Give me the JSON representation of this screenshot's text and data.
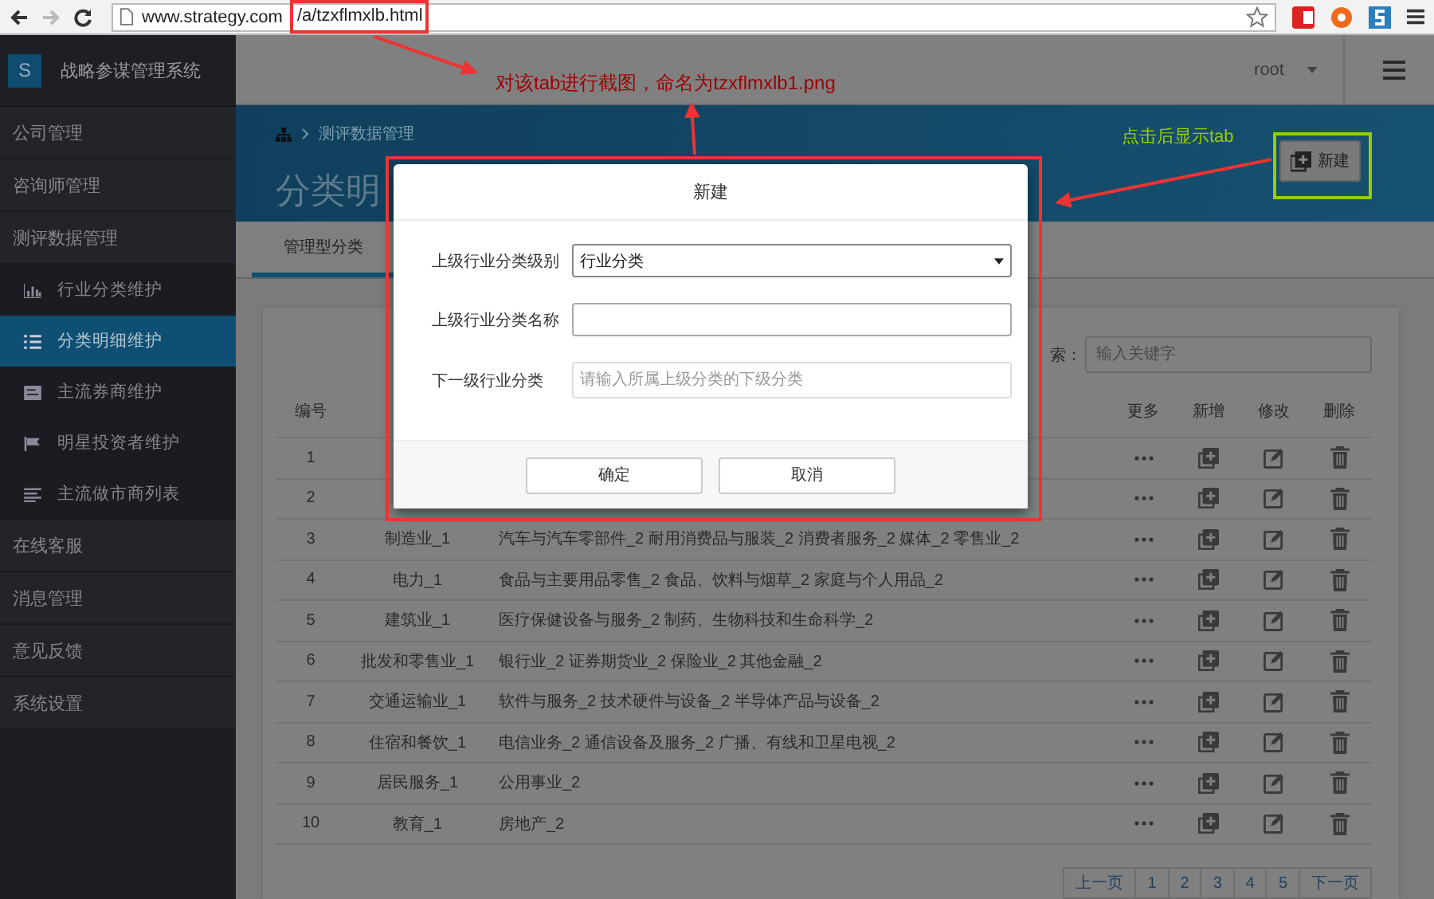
{
  "browser": {
    "url_host": "www.strategy.com",
    "url_path": "/a/tzxflmxlb.html"
  },
  "app": {
    "logo_letter": "S",
    "title": "战略参谋管理系统",
    "user": "root"
  },
  "sidebar": {
    "items": [
      {
        "label": "公司管理",
        "selected": false
      },
      {
        "label": "咨询师管理",
        "selected": false
      },
      {
        "label": "测评数据管理",
        "selected": false,
        "expanded": true,
        "children": [
          {
            "label": "行业分类维护",
            "selected": false
          },
          {
            "label": "分类明细维护",
            "selected": true
          },
          {
            "label": "主流券商维护",
            "selected": false
          },
          {
            "label": "明星投资者维护",
            "selected": false
          },
          {
            "label": "主流做市商列表",
            "selected": false
          }
        ]
      },
      {
        "label": "在线客服",
        "selected": false
      },
      {
        "label": "消息管理",
        "selected": false
      },
      {
        "label": "意见反馈",
        "selected": false
      },
      {
        "label": "系统设置",
        "selected": false
      }
    ]
  },
  "banner": {
    "breadcrumb": "测评数据管理",
    "title": "分类明",
    "new_button": "新建"
  },
  "tabs": [
    {
      "label": "管理型分类",
      "selected": true
    }
  ],
  "search": {
    "label": "索：",
    "placeholder": "输入关键字"
  },
  "table": {
    "columns": [
      "编号",
      "更多",
      "新增",
      "修改",
      "删除"
    ],
    "rows": [
      {
        "number": "1"
      },
      {
        "number": "2"
      },
      {
        "number": "3",
        "name": "制造业_1",
        "details": "汽车与汽车零部件_2  耐用消费品与服装_2  消费者服务_2  媒体_2  零售业_2"
      },
      {
        "number": "4",
        "name": "电力_1",
        "details": "食品与主要用品零售_2  食品、饮料与烟草_2  家庭与个人用品_2"
      },
      {
        "number": "5",
        "name": "建筑业_1",
        "details": "医疗保健设备与服务_2  制药、生物科技和生命科学_2"
      },
      {
        "number": "6",
        "name": "批发和零售业_1",
        "details": "银行业_2  证券期货业_2  保险业_2  其他金融_2"
      },
      {
        "number": "7",
        "name": "交通运输业_1",
        "details": "软件与服务_2  技术硬件与设备_2  半导体产品与设备_2"
      },
      {
        "number": "8",
        "name": "住宿和餐饮_1",
        "details": "电信业务_2  通信设备及服务_2  广播、有线和卫星电视_2"
      },
      {
        "number": "9",
        "name": "居民服务_1",
        "details": "公用事业_2"
      },
      {
        "number": "10",
        "name": "教育_1",
        "details": "房地产_2"
      }
    ]
  },
  "pagination": {
    "prev": "上一页",
    "pages": [
      "1",
      "2",
      "3",
      "4",
      "5"
    ],
    "next": "下一页"
  },
  "modal": {
    "title": "新建",
    "fields": [
      {
        "kind": "select",
        "label": "上级行业分类级别",
        "value": "行业分类"
      },
      {
        "kind": "input",
        "label": "上级行业分类名称"
      },
      {
        "kind": "input",
        "label": "下一级行业分类",
        "placeholder": "请输入所属上级分类的下级分类"
      }
    ],
    "buttons": [
      "确定",
      "取消"
    ]
  },
  "annotations": {
    "screenshot_note": "对该tab进行截图，命名为tzxflmxlb1.png",
    "click_note": "点击后显示tab"
  }
}
